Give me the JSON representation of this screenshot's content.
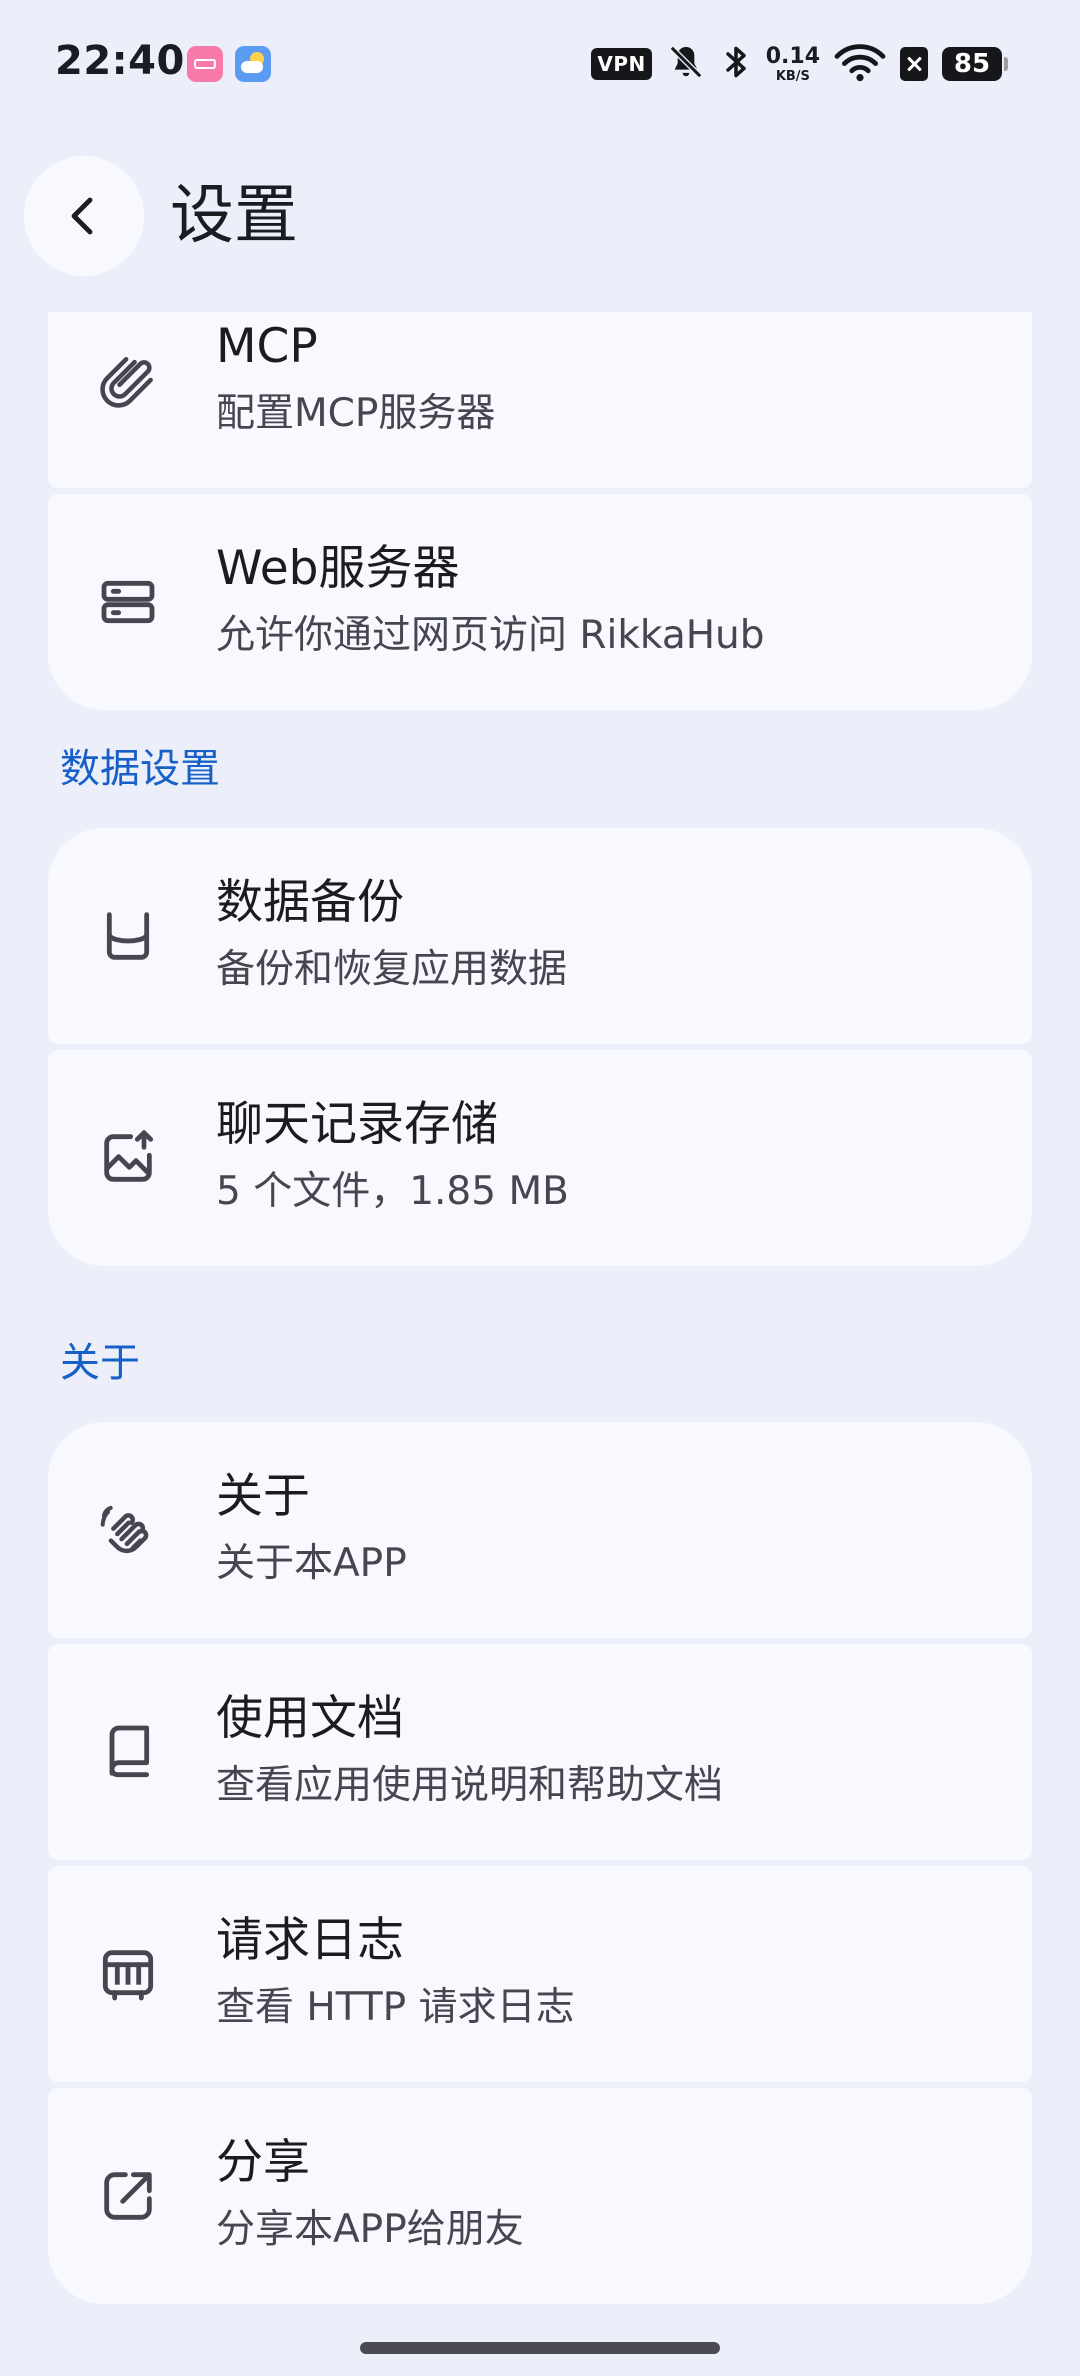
{
  "status_bar": {
    "time": "22:40",
    "vpn": "VPN",
    "net_speed_value": "0.14",
    "net_speed_unit": "KB/S",
    "battery": "85"
  },
  "header": {
    "title": "设置"
  },
  "sections": {
    "tools": {
      "items": [
        {
          "title": "MCP",
          "subtitle": "配置MCP服务器",
          "icon": "paperclip-icon"
        },
        {
          "title": "Web服务器",
          "subtitle": "允许你通过网页访问 RikkaHub",
          "icon": "server-icon"
        }
      ]
    },
    "data": {
      "header": "数据设置",
      "items": [
        {
          "title": "数据备份",
          "subtitle": "备份和恢复应用数据",
          "icon": "backup-icon"
        },
        {
          "title": "聊天记录存储",
          "subtitle": "5 个文件，1.85 MB",
          "icon": "image-upload-icon"
        }
      ]
    },
    "about": {
      "header": "关于",
      "items": [
        {
          "title": "关于",
          "subtitle": "关于本APP",
          "icon": "wave-hand-icon"
        },
        {
          "title": "使用文档",
          "subtitle": "查看应用使用说明和帮助文档",
          "icon": "book-icon"
        },
        {
          "title": "请求日志",
          "subtitle": "查看 HTTP 请求日志",
          "icon": "log-icon"
        },
        {
          "title": "分享",
          "subtitle": "分享本APP给朋友",
          "icon": "share-icon"
        }
      ]
    }
  }
}
